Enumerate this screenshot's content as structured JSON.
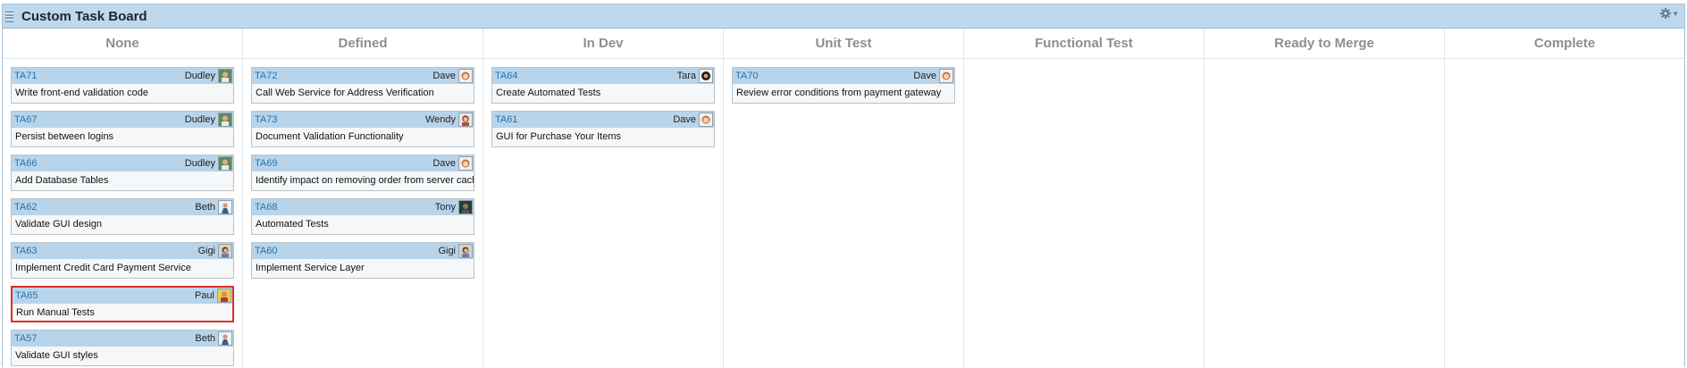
{
  "board": {
    "title": "Custom Task Board",
    "settings_icon": "gear-icon",
    "colors": {
      "header_bg": "#bfd8ec",
      "card_header_bg": "#b8d4ea",
      "id_link": "#1f74b5",
      "selected_border": "#d9302a"
    }
  },
  "columns": [
    {
      "name": "None",
      "cards": [
        {
          "id": "TA71",
          "owner": "Dudley",
          "avatar": "dudley",
          "name": "Write front-end validation code"
        },
        {
          "id": "TA67",
          "owner": "Dudley",
          "avatar": "dudley",
          "name": "Persist between logins"
        },
        {
          "id": "TA66",
          "owner": "Dudley",
          "avatar": "dudley",
          "name": "Add Database Tables"
        },
        {
          "id": "TA62",
          "owner": "Beth",
          "avatar": "beth",
          "name": "Validate GUI design"
        },
        {
          "id": "TA63",
          "owner": "Gigi",
          "avatar": "gigi",
          "name": "Implement Credit Card Payment Service"
        },
        {
          "id": "TA65",
          "owner": "Paul",
          "avatar": "paul",
          "name": "Run Manual Tests",
          "selected": true
        },
        {
          "id": "TA57",
          "owner": "Beth",
          "avatar": "beth",
          "name": "Validate GUI styles"
        }
      ]
    },
    {
      "name": "Defined",
      "cards": [
        {
          "id": "TA72",
          "owner": "Dave",
          "avatar": "dave",
          "name": "Call Web Service for Address Verification"
        },
        {
          "id": "TA73",
          "owner": "Wendy",
          "avatar": "wendy",
          "name": "Document Validation Functionality"
        },
        {
          "id": "TA69",
          "owner": "Dave",
          "avatar": "dave",
          "name": "Identify impact on removing order from server cache"
        },
        {
          "id": "TA68",
          "owner": "Tony",
          "avatar": "tony",
          "name": "Automated Tests"
        },
        {
          "id": "TA60",
          "owner": "Gigi",
          "avatar": "gigi",
          "name": "Implement Service Layer"
        }
      ]
    },
    {
      "name": "In Dev",
      "cards": [
        {
          "id": "TA64",
          "owner": "Tara",
          "avatar": "tara",
          "name": "Create Automated Tests"
        },
        {
          "id": "TA61",
          "owner": "Dave",
          "avatar": "dave",
          "name": "GUI for Purchase Your Items"
        }
      ]
    },
    {
      "name": "Unit Test",
      "cards": [
        {
          "id": "TA70",
          "owner": "Dave",
          "avatar": "dave",
          "name": "Review error conditions from payment gateway"
        }
      ]
    },
    {
      "name": "Functional Test",
      "cards": []
    },
    {
      "name": "Ready to Merge",
      "cards": []
    },
    {
      "name": "Complete",
      "cards": []
    }
  ]
}
